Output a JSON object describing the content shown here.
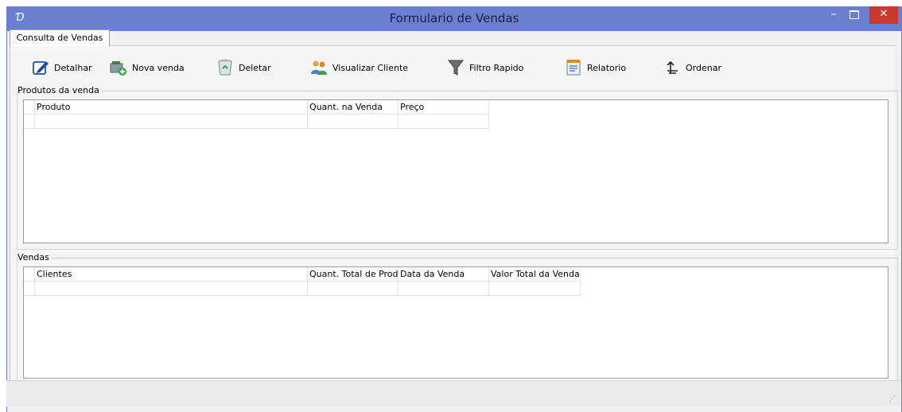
{
  "window": {
    "title": "Formulario de Vendas",
    "app_icon": "app-logo-icon",
    "controls": {
      "minimize": "–",
      "close": "✕"
    }
  },
  "tabs": [
    {
      "label": "Consulta de Vendas",
      "active": true
    }
  ],
  "toolbar": {
    "detalhar": "Detalhar",
    "nova_venda": "Nova venda",
    "deletar": "Deletar",
    "visualizar_cliente": "Visualizar Cliente",
    "filtro_rapido": "Filtro Rapido",
    "relatorio": "Relatorio",
    "ordenar": "Ordenar"
  },
  "produtos": {
    "legend": "Produtos da venda",
    "columns": [
      "Produto",
      "Quant. na Venda",
      "Preço"
    ]
  },
  "vendas": {
    "legend": "Vendas",
    "columns": [
      "Clientes",
      "Quant. Total de Prod",
      "Data da Venda",
      "Valor Total da Venda"
    ]
  },
  "colors": {
    "titlebar": "#6a7fd0",
    "close_button": "#c9392e"
  }
}
